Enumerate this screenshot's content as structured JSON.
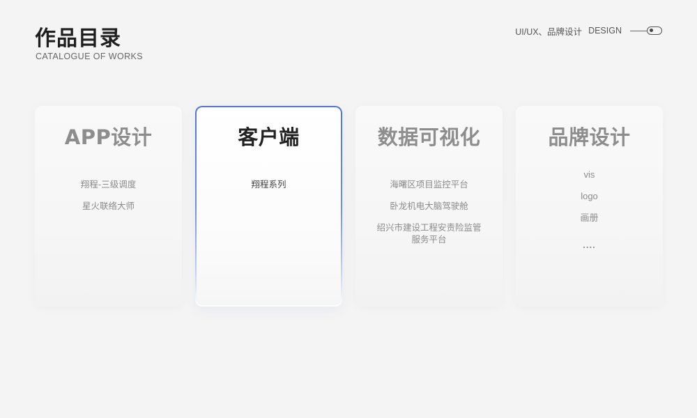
{
  "header": {
    "title": "作品目录",
    "subtitle": "CATALOGUE OF WORKS",
    "tag": "UI/UX、品牌设计",
    "tag2": "DESIGN"
  },
  "icons": [
    "toggle-icon"
  ],
  "colors": {
    "background": "#f4f4f4",
    "active_border": "#4f74df",
    "title_text": "#1f1f1f",
    "muted_text": "#8d8d8d"
  },
  "cards": [
    {
      "title": "APP设计",
      "items": [
        "翔程-三级调度",
        "星火联络大师"
      ],
      "active": false
    },
    {
      "title": "客户端",
      "items": [
        "翔程系列"
      ],
      "active": true
    },
    {
      "title": "数据可视化",
      "items": [
        "海曙区项目监控平台",
        "卧龙机电大脑驾驶舱",
        "绍兴市建设工程安责险监管服务平台"
      ],
      "active": false
    },
    {
      "title": "品牌设计",
      "items": [
        "vis",
        "logo",
        "画册",
        "...."
      ],
      "active": false
    }
  ]
}
